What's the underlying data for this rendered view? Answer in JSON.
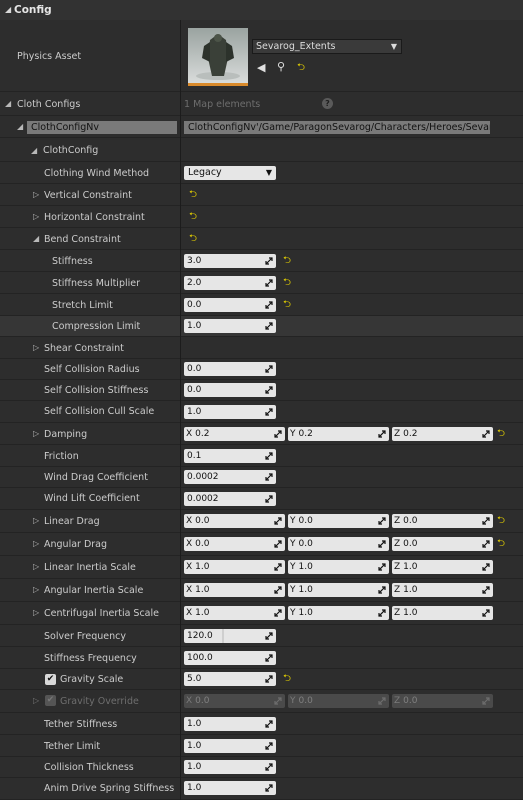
{
  "header": {
    "title": "Config"
  },
  "physics_asset": {
    "label": "Physics Asset",
    "asset_name": "Sevarog_Extents",
    "icons": [
      "thumbnail-image",
      "use-selected-arrow-icon",
      "browse-magnifier-icon",
      "reset-arrow-icon"
    ]
  },
  "cloth_configs": {
    "label": "Cloth Configs",
    "count": "1 Map elements",
    "key": "ClothConfigNv",
    "value": "ClothConfigNv'/Game/ParagonSevarog/Characters/Heroes/Sevarc",
    "sub": "ClothConfig"
  },
  "wind": {
    "label": "Clothing Wind Method",
    "value": "Legacy"
  },
  "groups": {
    "vertical": "Vertical Constraint",
    "horizontal": "Horizontal Constraint",
    "bend": "Bend Constraint",
    "shear": "Shear Constraint"
  },
  "bend": {
    "stiffness": {
      "label": "Stiffness",
      "value": "3.0"
    },
    "multiplier": {
      "label": "Stiffness Multiplier",
      "value": "2.0"
    },
    "stretch": {
      "label": "Stretch Limit",
      "value": "0.0"
    },
    "compression": {
      "label": "Compression Limit",
      "value": "1.0"
    }
  },
  "scalars": {
    "self_radius": {
      "label": "Self Collision Radius",
      "value": "0.0"
    },
    "self_stiffness": {
      "label": "Self Collision Stiffness",
      "value": "0.0"
    },
    "self_cull": {
      "label": "Self Collision Cull Scale",
      "value": "1.0"
    },
    "friction": {
      "label": "Friction",
      "value": "0.1"
    },
    "wind_drag": {
      "label": "Wind Drag Coefficient",
      "value": "0.0002"
    },
    "wind_lift": {
      "label": "Wind Lift Coefficient",
      "value": "0.0002"
    },
    "solver_freq": {
      "label": "Solver Frequency",
      "value": "120.0"
    },
    "stiff_freq": {
      "label": "Stiffness Frequency",
      "value": "100.0"
    },
    "gravity_scale": {
      "label": "Gravity Scale",
      "value": "5.0"
    },
    "tether_stiff": {
      "label": "Tether Stiffness",
      "value": "1.0"
    },
    "tether_limit": {
      "label": "Tether Limit",
      "value": "1.0"
    },
    "coll_thick": {
      "label": "Collision Thickness",
      "value": "1.0"
    },
    "anim_spring": {
      "label": "Anim Drive Spring Stiffness",
      "value": "1.0"
    }
  },
  "vectors": {
    "damping": {
      "label": "Damping",
      "x": "0.2",
      "y": "0.2",
      "z": "0.2"
    },
    "linear_drag": {
      "label": "Linear Drag",
      "x": "0.0",
      "y": "0.0",
      "z": "0.0"
    },
    "angular_drag": {
      "label": "Angular Drag",
      "x": "0.0",
      "y": "0.0",
      "z": "0.0"
    },
    "linear_inertia": {
      "label": "Linear Inertia Scale",
      "x": "1.0",
      "y": "1.0",
      "z": "1.0"
    },
    "angular_inertia": {
      "label": "Angular Inertia Scale",
      "x": "1.0",
      "y": "1.0",
      "z": "1.0"
    },
    "centrifugal_inertia": {
      "label": "Centrifugal Inertia Scale",
      "x": "1.0",
      "y": "1.0",
      "z": "1.0"
    },
    "gravity_override": {
      "label": "Gravity Override",
      "x": "0.0",
      "y": "0.0",
      "z": "0.0"
    }
  },
  "axes": {
    "x": "X",
    "y": "Y",
    "z": "Z"
  },
  "checks": {
    "gravity_scale": true,
    "gravity_override": true
  },
  "colors": {
    "reset_arrow": "#e4d000",
    "field_bg": "#e6e6e6",
    "thumb_underline": "#d98a2b"
  }
}
